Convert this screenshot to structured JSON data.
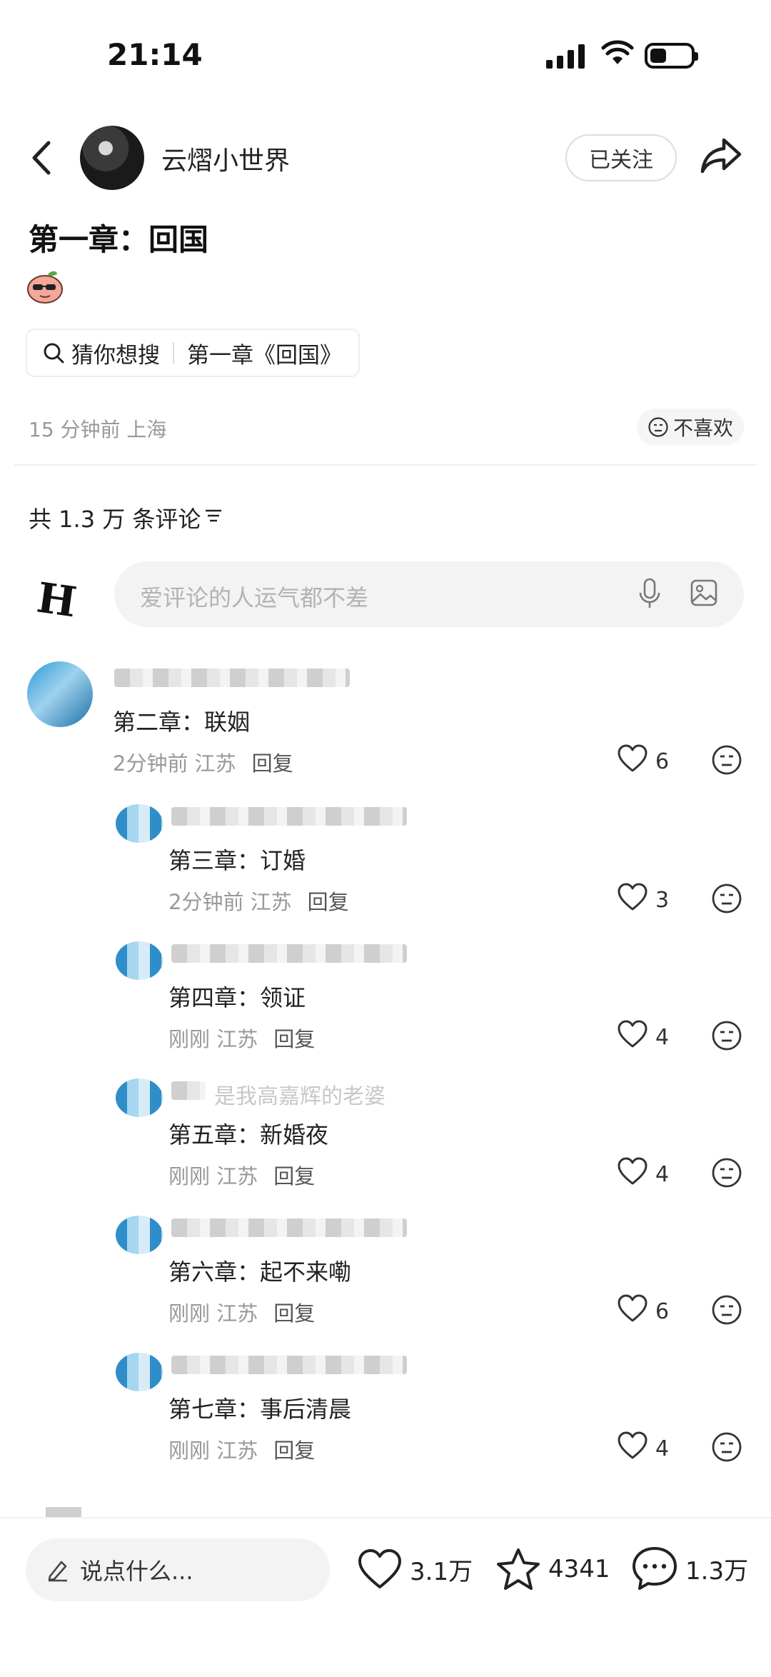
{
  "status_bar": {
    "time": "21:14"
  },
  "post": {
    "author": "云熠小世界",
    "follow_label": "已关注",
    "title": "第一章：回国",
    "search_chip": {
      "prefix": "猜你想搜",
      "query": "第一章《回国》"
    },
    "meta": "15 分钟前 上海",
    "dislike_label": "不喜欢"
  },
  "comments_section": {
    "count_label": "共 1.3 万 条评论",
    "input_placeholder": "爱评论的人运气都不差",
    "comments": [
      {
        "text": "第二章：联姻",
        "meta": "2分钟前 江苏",
        "reply": "回复",
        "likes": "6"
      },
      {
        "text": "第三章：订婚",
        "meta": "2分钟前 江苏",
        "reply": "回复",
        "likes": "3"
      },
      {
        "text": "第四章：领证",
        "meta": "刚刚 江苏",
        "reply": "回复",
        "likes": "4"
      },
      {
        "text": "第五章：新婚夜",
        "meta": "刚刚 江苏",
        "reply": "回复",
        "likes": "4",
        "username": "是我高嘉辉的老婆"
      },
      {
        "text": "第六章：起不来嘞",
        "meta": "刚刚 江苏",
        "reply": "回复",
        "likes": "6"
      },
      {
        "text": "第七章：事后清晨",
        "meta": "刚刚 江苏",
        "reply": "回复",
        "likes": "4"
      }
    ]
  },
  "bottom_bar": {
    "say_placeholder": "说点什么...",
    "likes": "3.1万",
    "favorites": "4341",
    "comments": "1.3万"
  },
  "colors": {
    "accent": "#222222",
    "meta_gray": "#999999",
    "input_bg": "#f3f3f3"
  }
}
